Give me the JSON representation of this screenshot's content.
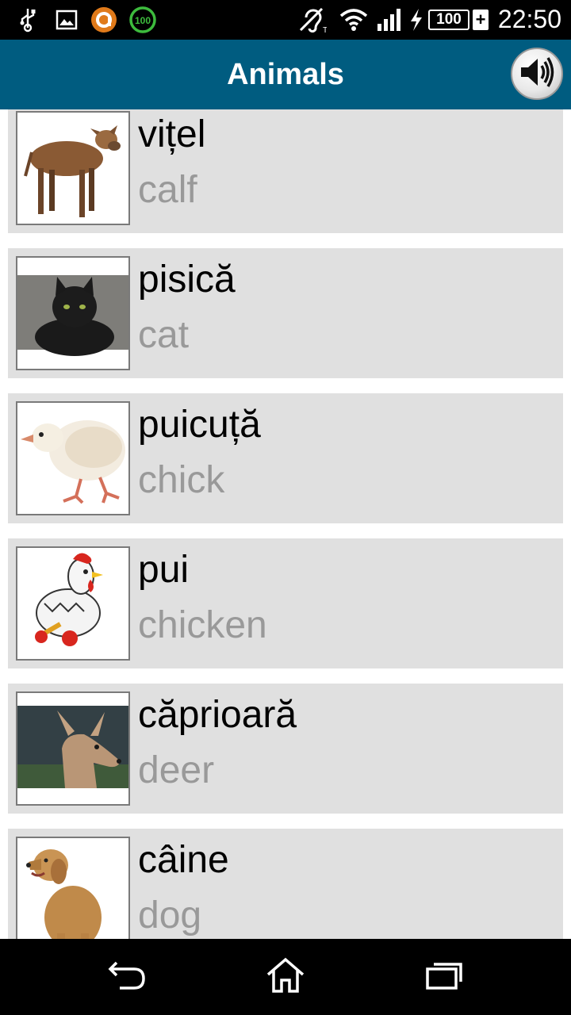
{
  "status_bar": {
    "time": "22:50",
    "battery": "100",
    "icons": [
      "usb-icon",
      "image-icon",
      "app-notification-icon",
      "battery-100-badge-icon",
      "hearing-aid-icon",
      "wifi-icon",
      "signal-icon",
      "charging-icon"
    ],
    "badge_text": "100"
  },
  "app_bar": {
    "title": "Animals",
    "sound_icon": "speaker-icon"
  },
  "items": [
    {
      "word": "vițel",
      "translation": "calf",
      "image": "calf-image"
    },
    {
      "word": "pisică",
      "translation": "cat",
      "image": "cat-image"
    },
    {
      "word": "puicuță",
      "translation": "chick",
      "image": "chick-image"
    },
    {
      "word": "pui",
      "translation": "chicken",
      "image": "chicken-image"
    },
    {
      "word": "căprioară",
      "translation": "deer",
      "image": "deer-image"
    },
    {
      "word": "câine",
      "translation": "dog",
      "image": "dog-image"
    }
  ],
  "nav_bar": {
    "icons": [
      "back-icon",
      "home-icon",
      "recents-icon"
    ]
  }
}
